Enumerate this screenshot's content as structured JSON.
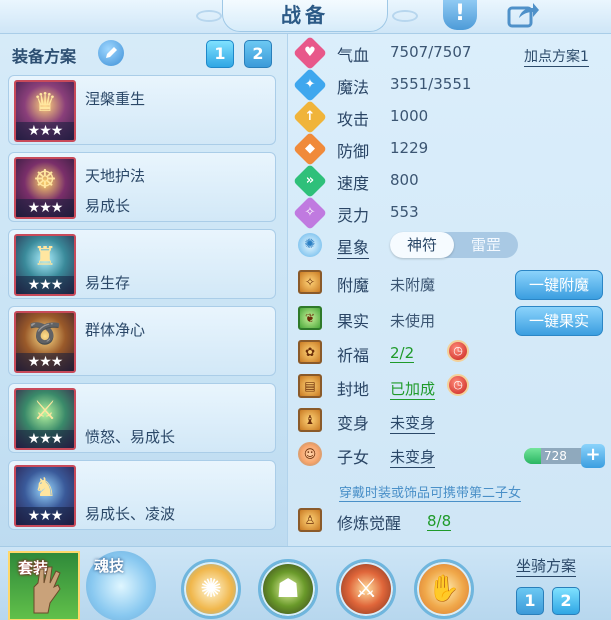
{
  "header": {
    "title": "战备"
  },
  "left": {
    "title": "装备方案",
    "scheme_buttons": [
      "1",
      "2"
    ],
    "equipment": [
      {
        "name": "涅槃重生",
        "line2": "",
        "stars": "★★★"
      },
      {
        "name": "天地护法",
        "line2": "易成长",
        "stars": "★★★"
      },
      {
        "name": "",
        "line2": "易生存",
        "stars": "★★★"
      },
      {
        "name": "群体净心",
        "line2": "",
        "stars": "★★★"
      },
      {
        "name": "",
        "line2": "愤怒、易成长",
        "stars": "★★★"
      },
      {
        "name": "",
        "line2": "易成长、凌波",
        "stars": "★★★"
      }
    ]
  },
  "stats": {
    "addpoint_link": "加点方案1",
    "rows": [
      {
        "label": "气血",
        "value": "7507/7507",
        "color": "#e8588a",
        "icon": "heart-icon",
        "glyph": "♥"
      },
      {
        "label": "魔法",
        "value": "3551/3551",
        "color": "#3fa7ee",
        "icon": "mana-icon",
        "glyph": "✦"
      },
      {
        "label": "攻击",
        "value": "1000",
        "color": "#f0b43a",
        "icon": "attack-icon",
        "glyph": "↑"
      },
      {
        "label": "防御",
        "value": "1229",
        "color": "#f08a3a",
        "icon": "defense-icon",
        "glyph": "◆"
      },
      {
        "label": "速度",
        "value": "800",
        "color": "#2fc07a",
        "icon": "speed-icon",
        "glyph": "»"
      },
      {
        "label": "灵力",
        "value": "553",
        "color": "#c07ae0",
        "icon": "spirit-icon",
        "glyph": "✧"
      }
    ]
  },
  "xing": {
    "label": "星象",
    "opt_on": "神符",
    "opt_off": "雷罡"
  },
  "details": {
    "fumo": {
      "label": "附魔",
      "value": "未附魔",
      "button": "一键附魔"
    },
    "guoshi": {
      "label": "果实",
      "value": "未使用",
      "button": "一键果实"
    },
    "qifu": {
      "label": "祈福",
      "value": "2/2"
    },
    "fengdi": {
      "label": "封地",
      "value": "已加成"
    },
    "bianshen": {
      "label": "变身",
      "value": "未变身"
    },
    "zinv": {
      "label": "子女",
      "value": "未变身",
      "bar_value": "728",
      "bar_fraction": 0.22
    },
    "hint": "穿戴时装或饰品可携带第二子女",
    "xiulian": {
      "label": "修炼觉醒",
      "value": "8/8"
    }
  },
  "bottom": {
    "tab_suit": "套装",
    "tab_soul": "魂技",
    "mount_title": "坐骑方案",
    "mount_buttons": [
      "1",
      "2"
    ]
  }
}
